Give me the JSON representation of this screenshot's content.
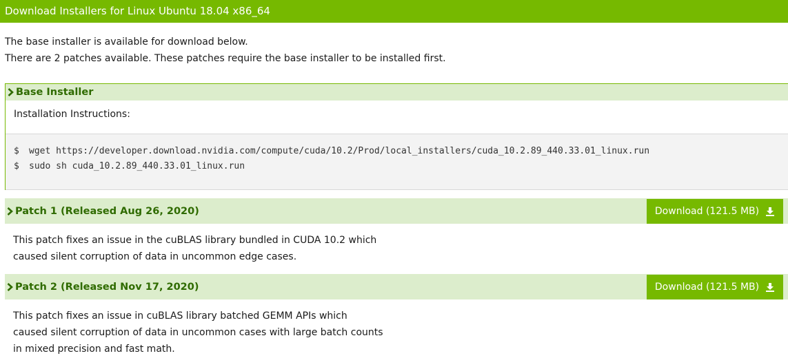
{
  "header": {
    "title": "Download Installers for Linux Ubuntu 18.04 x86_64"
  },
  "intro": {
    "line1": "The base installer is available for download below.",
    "line2": "There are 2 patches available. These patches require the base installer to be installed first."
  },
  "base_installer": {
    "title": "Base Installer",
    "instructions_label": "Installation Instructions:",
    "commands": [
      {
        "prompt": "$",
        "text": "wget https://developer.download.nvidia.com/compute/cuda/10.2/Prod/local_installers/cuda_10.2.89_440.33.01_linux.run"
      },
      {
        "prompt": "$",
        "text": "sudo sh cuda_10.2.89_440.33.01_linux.run"
      }
    ]
  },
  "patches": [
    {
      "title": "Patch 1 (Released Aug 26, 2020)",
      "download_label": "Download (121.5 MB)",
      "description": [
        "This patch fixes an issue in the cuBLAS library bundled in CUDA 10.2 which",
        "caused silent corruption of data in uncommon edge cases."
      ]
    },
    {
      "title": "Patch 2 (Released Nov 17, 2020)",
      "download_label": "Download (121.5 MB)",
      "description": [
        "This patch fixes an issue in cuBLAS library batched GEMM APIs which",
        "caused silent corruption of data in uncommon cases with large batch counts",
        "in mixed precision and fast math."
      ]
    }
  ],
  "icons": {
    "section": "chevron-right-icon",
    "download": "download-icon"
  },
  "colors": {
    "brand_green": "#76b900",
    "section_bg": "#dcedcc",
    "section_text": "#2f6b00",
    "code_bg": "#f3f3f3"
  }
}
